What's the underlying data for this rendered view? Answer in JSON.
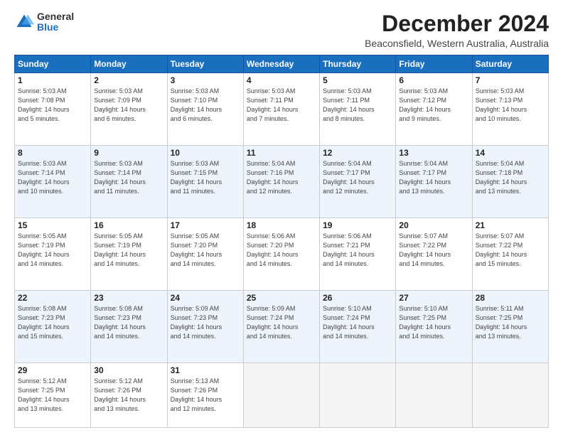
{
  "logo": {
    "general": "General",
    "blue": "Blue"
  },
  "title": "December 2024",
  "subtitle": "Beaconsfield, Western Australia, Australia",
  "headers": [
    "Sunday",
    "Monday",
    "Tuesday",
    "Wednesday",
    "Thursday",
    "Friday",
    "Saturday"
  ],
  "weeks": [
    [
      {
        "day": "1",
        "sunrise": "Sunrise: 5:03 AM",
        "sunset": "Sunset: 7:08 PM",
        "daylight": "Daylight: 14 hours and 5 minutes."
      },
      {
        "day": "2",
        "sunrise": "Sunrise: 5:03 AM",
        "sunset": "Sunset: 7:09 PM",
        "daylight": "Daylight: 14 hours and 6 minutes."
      },
      {
        "day": "3",
        "sunrise": "Sunrise: 5:03 AM",
        "sunset": "Sunset: 7:10 PM",
        "daylight": "Daylight: 14 hours and 6 minutes."
      },
      {
        "day": "4",
        "sunrise": "Sunrise: 5:03 AM",
        "sunset": "Sunset: 7:11 PM",
        "daylight": "Daylight: 14 hours and 7 minutes."
      },
      {
        "day": "5",
        "sunrise": "Sunrise: 5:03 AM",
        "sunset": "Sunset: 7:11 PM",
        "daylight": "Daylight: 14 hours and 8 minutes."
      },
      {
        "day": "6",
        "sunrise": "Sunrise: 5:03 AM",
        "sunset": "Sunset: 7:12 PM",
        "daylight": "Daylight: 14 hours and 9 minutes."
      },
      {
        "day": "7",
        "sunrise": "Sunrise: 5:03 AM",
        "sunset": "Sunset: 7:13 PM",
        "daylight": "Daylight: 14 hours and 10 minutes."
      }
    ],
    [
      {
        "day": "8",
        "sunrise": "Sunrise: 5:03 AM",
        "sunset": "Sunset: 7:14 PM",
        "daylight": "Daylight: 14 hours and 10 minutes."
      },
      {
        "day": "9",
        "sunrise": "Sunrise: 5:03 AM",
        "sunset": "Sunset: 7:14 PM",
        "daylight": "Daylight: 14 hours and 11 minutes."
      },
      {
        "day": "10",
        "sunrise": "Sunrise: 5:03 AM",
        "sunset": "Sunset: 7:15 PM",
        "daylight": "Daylight: 14 hours and 11 minutes."
      },
      {
        "day": "11",
        "sunrise": "Sunrise: 5:04 AM",
        "sunset": "Sunset: 7:16 PM",
        "daylight": "Daylight: 14 hours and 12 minutes."
      },
      {
        "day": "12",
        "sunrise": "Sunrise: 5:04 AM",
        "sunset": "Sunset: 7:17 PM",
        "daylight": "Daylight: 14 hours and 12 minutes."
      },
      {
        "day": "13",
        "sunrise": "Sunrise: 5:04 AM",
        "sunset": "Sunset: 7:17 PM",
        "daylight": "Daylight: 14 hours and 13 minutes."
      },
      {
        "day": "14",
        "sunrise": "Sunrise: 5:04 AM",
        "sunset": "Sunset: 7:18 PM",
        "daylight": "Daylight: 14 hours and 13 minutes."
      }
    ],
    [
      {
        "day": "15",
        "sunrise": "Sunrise: 5:05 AM",
        "sunset": "Sunset: 7:19 PM",
        "daylight": "Daylight: 14 hours and 14 minutes."
      },
      {
        "day": "16",
        "sunrise": "Sunrise: 5:05 AM",
        "sunset": "Sunset: 7:19 PM",
        "daylight": "Daylight: 14 hours and 14 minutes."
      },
      {
        "day": "17",
        "sunrise": "Sunrise: 5:05 AM",
        "sunset": "Sunset: 7:20 PM",
        "daylight": "Daylight: 14 hours and 14 minutes."
      },
      {
        "day": "18",
        "sunrise": "Sunrise: 5:06 AM",
        "sunset": "Sunset: 7:20 PM",
        "daylight": "Daylight: 14 hours and 14 minutes."
      },
      {
        "day": "19",
        "sunrise": "Sunrise: 5:06 AM",
        "sunset": "Sunset: 7:21 PM",
        "daylight": "Daylight: 14 hours and 14 minutes."
      },
      {
        "day": "20",
        "sunrise": "Sunrise: 5:07 AM",
        "sunset": "Sunset: 7:22 PM",
        "daylight": "Daylight: 14 hours and 14 minutes."
      },
      {
        "day": "21",
        "sunrise": "Sunrise: 5:07 AM",
        "sunset": "Sunset: 7:22 PM",
        "daylight": "Daylight: 14 hours and 15 minutes."
      }
    ],
    [
      {
        "day": "22",
        "sunrise": "Sunrise: 5:08 AM",
        "sunset": "Sunset: 7:23 PM",
        "daylight": "Daylight: 14 hours and 15 minutes."
      },
      {
        "day": "23",
        "sunrise": "Sunrise: 5:08 AM",
        "sunset": "Sunset: 7:23 PM",
        "daylight": "Daylight: 14 hours and 14 minutes."
      },
      {
        "day": "24",
        "sunrise": "Sunrise: 5:09 AM",
        "sunset": "Sunset: 7:23 PM",
        "daylight": "Daylight: 14 hours and 14 minutes."
      },
      {
        "day": "25",
        "sunrise": "Sunrise: 5:09 AM",
        "sunset": "Sunset: 7:24 PM",
        "daylight": "Daylight: 14 hours and 14 minutes."
      },
      {
        "day": "26",
        "sunrise": "Sunrise: 5:10 AM",
        "sunset": "Sunset: 7:24 PM",
        "daylight": "Daylight: 14 hours and 14 minutes."
      },
      {
        "day": "27",
        "sunrise": "Sunrise: 5:10 AM",
        "sunset": "Sunset: 7:25 PM",
        "daylight": "Daylight: 14 hours and 14 minutes."
      },
      {
        "day": "28",
        "sunrise": "Sunrise: 5:11 AM",
        "sunset": "Sunset: 7:25 PM",
        "daylight": "Daylight: 14 hours and 13 minutes."
      }
    ],
    [
      {
        "day": "29",
        "sunrise": "Sunrise: 5:12 AM",
        "sunset": "Sunset: 7:25 PM",
        "daylight": "Daylight: 14 hours and 13 minutes."
      },
      {
        "day": "30",
        "sunrise": "Sunrise: 5:12 AM",
        "sunset": "Sunset: 7:26 PM",
        "daylight": "Daylight: 14 hours and 13 minutes."
      },
      {
        "day": "31",
        "sunrise": "Sunrise: 5:13 AM",
        "sunset": "Sunset: 7:26 PM",
        "daylight": "Daylight: 14 hours and 12 minutes."
      },
      null,
      null,
      null,
      null
    ]
  ]
}
